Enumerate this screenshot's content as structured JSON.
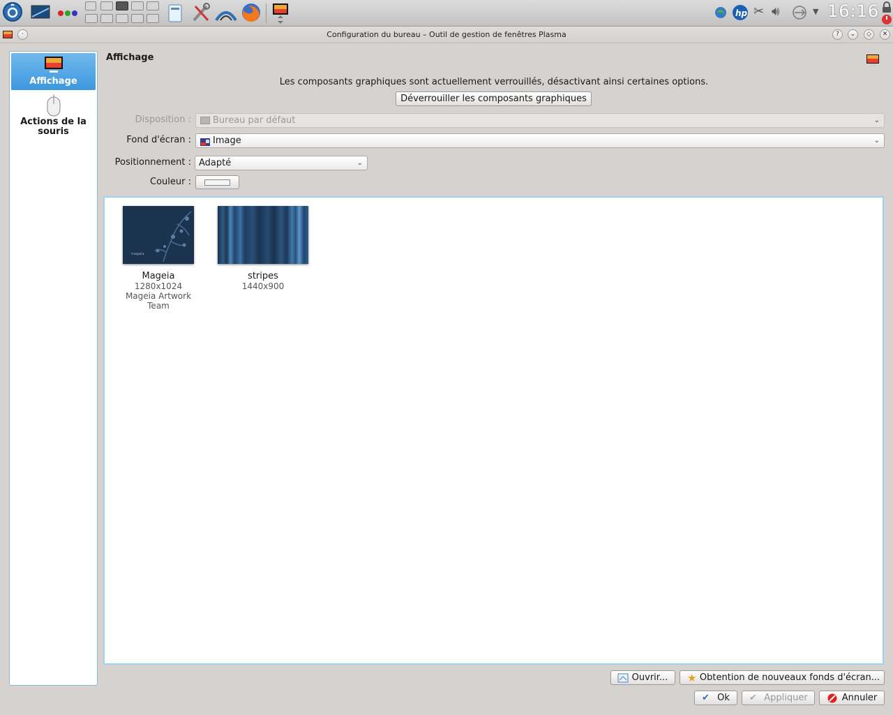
{
  "panel": {
    "clock": "16:16",
    "launchers": [
      "kickoff-menu-icon",
      "desktop-icon",
      "activity-dots-icon",
      "file-manager-icon",
      "settings-tools-icon",
      "mageia-control-center-icon",
      "firefox-icon",
      "desktop-settings-task-icon"
    ],
    "tray": [
      "network-globe-icon",
      "hp-printer-icon",
      "clipboard-scissors-icon",
      "volume-icon",
      "usb-icon",
      "tray-expand-icon"
    ]
  },
  "window": {
    "title": "Configuration du bureau – Outil de gestion de fenêtres Plasma",
    "buttons": [
      "?",
      "⌄",
      "◇",
      "✕"
    ]
  },
  "sidebar": {
    "items": [
      {
        "label": "Affichage",
        "icon": "display-icon",
        "selected": true
      },
      {
        "label": "Actions de la souris",
        "icon": "mouse-icon",
        "selected": false
      }
    ]
  },
  "main": {
    "title": "Affichage",
    "locked_message": "Les composants graphiques sont actuellement verrouillés, désactivant ainsi certaines options.",
    "unlock_button": "Déverrouiller les composants graphiques",
    "layout_label": "Disposition :",
    "layout_value": "Bureau par défaut",
    "wallpaper_label": "Fond d'écran :",
    "wallpaper_value": "Image",
    "positioning_label": "Positionnement :",
    "positioning_value": "Adapté",
    "color_label": "Couleur :",
    "wallpapers": [
      {
        "name": "Mageia",
        "resolution": "1280x1024",
        "author": "Mageia Artwork Team",
        "watermark": "mageia"
      },
      {
        "name": "stripes",
        "resolution": "1440x900",
        "author": ""
      }
    ]
  },
  "footer": {
    "open_button": "Ouvrir...",
    "get_new_button": "Obtention de nouveaux fonds d'écran...",
    "ok_button": "Ok",
    "apply_button": "Appliquer",
    "cancel_button": "Annuler"
  },
  "colors": {
    "selection": "#3d98dd",
    "focus_border": "#9fd2f2",
    "window_bg": "#d6d2d0"
  }
}
